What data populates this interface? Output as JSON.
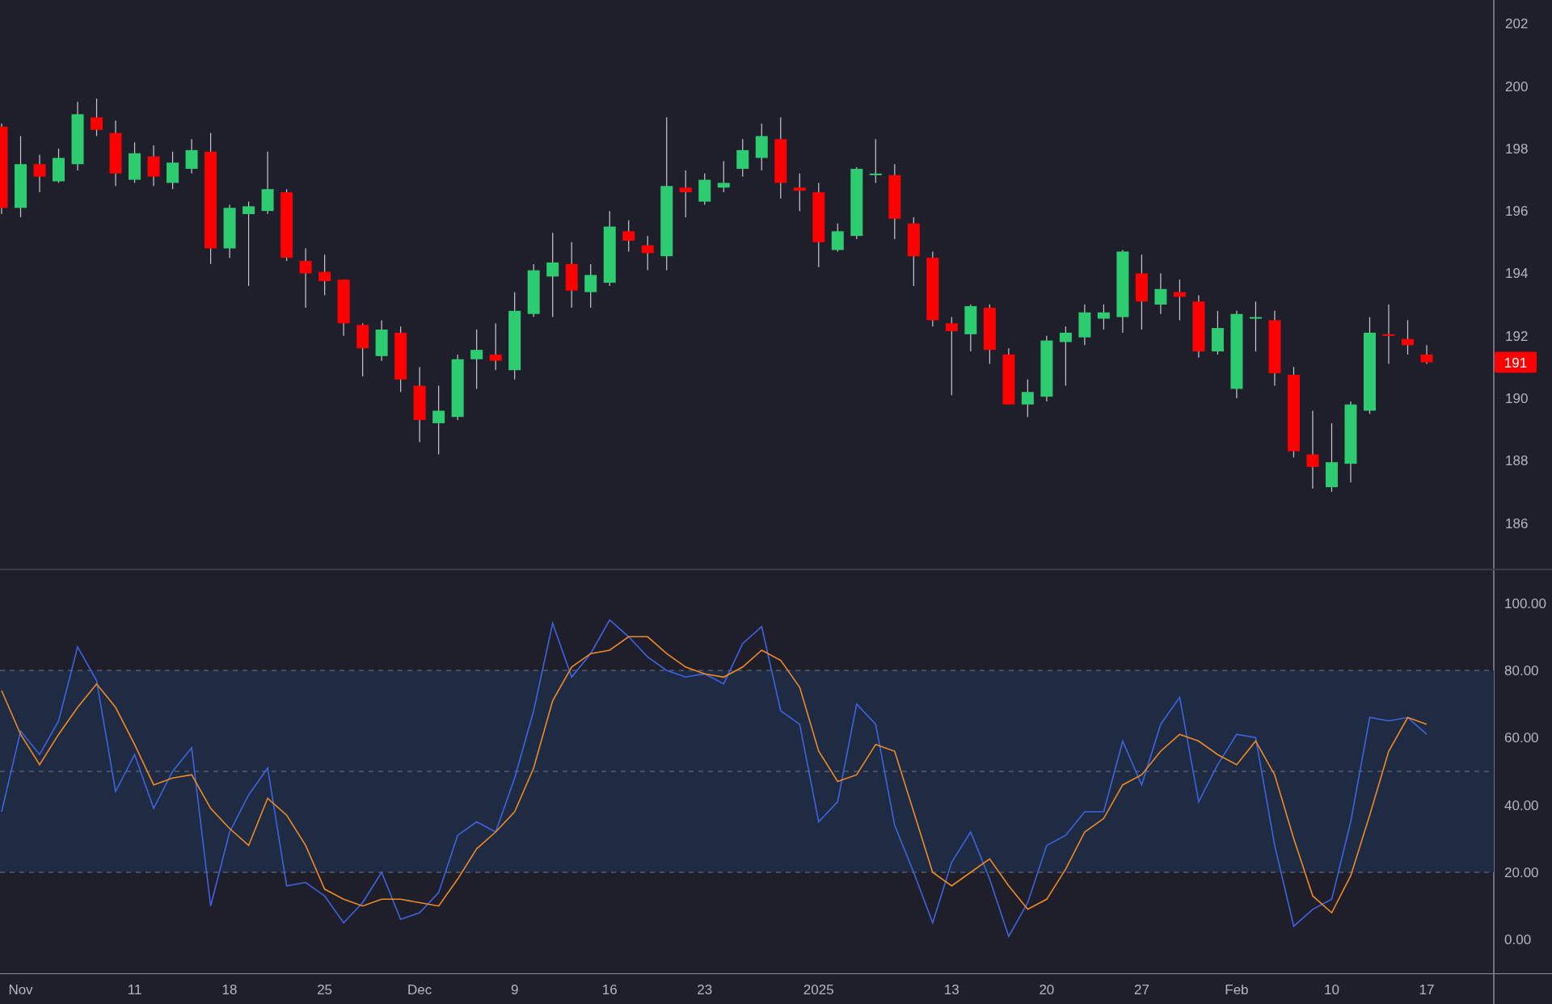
{
  "price_panel": {
    "last_price": "191",
    "chart_data": {
      "type": "candlestick",
      "ylim": [
        184.54,
        202.76
      ],
      "yticks": [
        186,
        188,
        190,
        192,
        194,
        196,
        198,
        200,
        202
      ],
      "categories": [
        null,
        null,
        null,
        null,
        null,
        null,
        null,
        null,
        null,
        null,
        null,
        null,
        null,
        null,
        null,
        null,
        null,
        null,
        null,
        null,
        null,
        null,
        null,
        null,
        null,
        null,
        null,
        null,
        null,
        null,
        null,
        null,
        null,
        null,
        null,
        null,
        null,
        null,
        null,
        null,
        null,
        null,
        null,
        null,
        null,
        null,
        null,
        null,
        null,
        null,
        null,
        null,
        null,
        null,
        null,
        null,
        null,
        null,
        null,
        null,
        null,
        null,
        null,
        null,
        null,
        null,
        null,
        null,
        null,
        null,
        null,
        null,
        null,
        null,
        null,
        null
      ],
      "ohlc": [
        [
          198.7,
          198.8,
          195.9,
          196.1
        ],
        [
          196.1,
          198.4,
          195.8,
          197.5
        ],
        [
          197.5,
          197.8,
          196.6,
          197.1
        ],
        [
          196.95,
          198.0,
          196.9,
          197.7
        ],
        [
          197.5,
          199.5,
          197.3,
          199.1
        ],
        [
          199.0,
          199.6,
          198.4,
          198.6
        ],
        [
          198.5,
          198.9,
          196.8,
          197.2
        ],
        [
          197.0,
          198.2,
          196.9,
          197.85
        ],
        [
          197.75,
          198.1,
          196.8,
          197.1
        ],
        [
          196.9,
          197.9,
          196.7,
          197.55
        ],
        [
          197.35,
          198.3,
          197.2,
          197.95
        ],
        [
          197.9,
          198.5,
          194.3,
          194.8
        ],
        [
          194.8,
          196.2,
          194.5,
          196.1
        ],
        [
          195.9,
          196.3,
          193.6,
          196.15
        ],
        [
          196.0,
          197.9,
          195.9,
          196.7
        ],
        [
          196.6,
          196.7,
          194.4,
          194.5
        ],
        [
          194.4,
          194.8,
          192.9,
          194.0
        ],
        [
          194.05,
          194.6,
          193.3,
          193.75
        ],
        [
          193.8,
          193.8,
          192.0,
          192.4
        ],
        [
          192.35,
          192.4,
          190.7,
          191.6
        ],
        [
          191.35,
          192.5,
          191.2,
          192.2
        ],
        [
          192.1,
          192.3,
          190.2,
          190.6
        ],
        [
          190.4,
          191.0,
          188.6,
          189.3
        ],
        [
          189.2,
          190.4,
          188.2,
          189.6
        ],
        [
          189.4,
          191.4,
          189.3,
          191.25
        ],
        [
          191.25,
          192.2,
          190.3,
          191.55
        ],
        [
          191.4,
          192.4,
          190.9,
          191.2
        ],
        [
          190.9,
          193.4,
          190.6,
          192.8
        ],
        [
          192.7,
          194.3,
          192.6,
          194.1
        ],
        [
          193.9,
          195.3,
          192.6,
          194.35
        ],
        [
          194.3,
          195.0,
          192.9,
          193.45
        ],
        [
          193.4,
          194.3,
          192.9,
          193.95
        ],
        [
          193.7,
          196.0,
          193.6,
          195.5
        ],
        [
          195.35,
          195.7,
          194.7,
          195.05
        ],
        [
          194.9,
          195.2,
          194.1,
          194.65
        ],
        [
          194.55,
          199.0,
          194.1,
          196.8
        ],
        [
          196.75,
          197.3,
          195.8,
          196.6
        ],
        [
          196.3,
          197.2,
          196.2,
          197.0
        ],
        [
          196.75,
          197.6,
          196.6,
          196.9
        ],
        [
          197.35,
          198.3,
          197.1,
          197.95
        ],
        [
          197.7,
          198.8,
          197.3,
          198.4
        ],
        [
          198.3,
          199.0,
          196.4,
          196.9
        ],
        [
          196.75,
          197.2,
          196.0,
          196.65
        ],
        [
          196.6,
          196.9,
          194.2,
          195.0
        ],
        [
          194.75,
          195.6,
          194.7,
          195.35
        ],
        [
          195.2,
          197.4,
          195.1,
          197.35
        ],
        [
          197.15,
          198.3,
          196.9,
          197.2
        ],
        [
          197.15,
          197.5,
          195.1,
          195.75
        ],
        [
          195.6,
          195.8,
          193.6,
          194.55
        ],
        [
          194.5,
          194.7,
          192.3,
          192.5
        ],
        [
          192.4,
          192.6,
          190.1,
          192.15
        ],
        [
          192.05,
          193.0,
          191.5,
          192.95
        ],
        [
          192.9,
          193.0,
          191.1,
          191.55
        ],
        [
          191.4,
          191.6,
          189.8,
          189.8
        ],
        [
          189.8,
          190.6,
          189.4,
          190.2
        ],
        [
          190.05,
          192.0,
          189.9,
          191.85
        ],
        [
          191.8,
          192.3,
          190.4,
          192.1
        ],
        [
          191.95,
          193.0,
          191.7,
          192.75
        ],
        [
          192.55,
          193.0,
          192.2,
          192.75
        ],
        [
          192.6,
          194.75,
          192.1,
          194.7
        ],
        [
          194.0,
          194.6,
          192.2,
          193.1
        ],
        [
          193.0,
          194.0,
          192.7,
          193.5
        ],
        [
          193.4,
          193.8,
          192.5,
          193.25
        ],
        [
          193.1,
          193.3,
          191.3,
          191.5
        ],
        [
          191.5,
          192.8,
          191.4,
          192.25
        ],
        [
          190.3,
          192.8,
          190.0,
          192.7
        ],
        [
          192.55,
          193.1,
          191.5,
          192.6
        ],
        [
          192.5,
          192.8,
          190.4,
          190.8
        ],
        [
          190.75,
          191.0,
          188.1,
          188.3
        ],
        [
          188.2,
          189.6,
          187.1,
          187.8
        ],
        [
          187.15,
          189.2,
          187.0,
          187.95
        ],
        [
          187.9,
          189.9,
          187.3,
          189.8
        ],
        [
          189.6,
          192.6,
          189.5,
          192.1
        ],
        [
          192.05,
          193.0,
          191.1,
          192.0
        ],
        [
          191.9,
          192.5,
          191.4,
          191.7
        ],
        [
          191.4,
          191.7,
          191.1,
          191.15
        ]
      ]
    }
  },
  "stochastic_panel": {
    "chart_data": {
      "type": "line",
      "ylim": [
        -10,
        110
      ],
      "yticks": [
        {
          "value": 0,
          "label": "0.00"
        },
        {
          "value": 20,
          "label": "20.00"
        },
        {
          "value": 40,
          "label": "40.00"
        },
        {
          "value": 60,
          "label": "60.00"
        },
        {
          "value": 80,
          "label": "80.00"
        },
        {
          "value": 100,
          "label": "100.00"
        }
      ],
      "categories": [
        null,
        "Nov",
        null,
        null,
        null,
        null,
        null,
        "11",
        null,
        null,
        null,
        null,
        "18",
        null,
        null,
        null,
        null,
        "25",
        null,
        null,
        null,
        null,
        "Dec",
        null,
        null,
        null,
        null,
        "9",
        null,
        null,
        null,
        null,
        "16",
        null,
        null,
        null,
        null,
        "23",
        null,
        null,
        null,
        null,
        null,
        "2025",
        null,
        null,
        null,
        null,
        null,
        null,
        "13",
        null,
        null,
        null,
        null,
        "20",
        null,
        null,
        null,
        null,
        "27",
        null,
        null,
        null,
        null,
        "Feb",
        null,
        null,
        null,
        null,
        "10",
        null,
        null,
        null,
        null,
        "17"
      ],
      "series": [
        {
          "color": "#3f63e0",
          "values": [
            38,
            62,
            55,
            65,
            87,
            77,
            44,
            55,
            39,
            50,
            57,
            10,
            32,
            43,
            51,
            16,
            17,
            13,
            5,
            11,
            20,
            6,
            8,
            14,
            31,
            35,
            32,
            48,
            68,
            94,
            78,
            85,
            95,
            90,
            84,
            80,
            78,
            79,
            76,
            88,
            93,
            68,
            64,
            35,
            41,
            70,
            64,
            34,
            20,
            5,
            23,
            32,
            18,
            1,
            11,
            28,
            31,
            38,
            38,
            59,
            46,
            64,
            72,
            41,
            52,
            61,
            60,
            28,
            4,
            9,
            12,
            35,
            66,
            65,
            66,
            61
          ]
        },
        {
          "color": "#f08a24",
          "values": [
            74,
            61,
            52,
            61,
            69,
            76,
            69,
            58,
            46,
            48,
            49,
            39,
            33,
            28,
            42,
            37,
            28,
            15,
            12,
            10,
            12,
            12,
            11,
            10,
            18,
            27,
            32,
            38,
            51,
            71,
            81,
            85,
            86,
            90,
            90,
            85,
            81,
            79,
            78,
            81,
            86,
            83,
            75,
            56,
            47,
            49,
            58,
            56,
            38,
            20,
            16,
            20,
            24,
            16,
            9,
            12,
            21,
            32,
            36,
            46,
            49,
            56,
            61,
            59,
            55,
            52,
            59,
            49,
            30,
            13,
            8,
            19,
            37,
            56,
            66,
            64
          ]
        }
      ]
    }
  }
}
